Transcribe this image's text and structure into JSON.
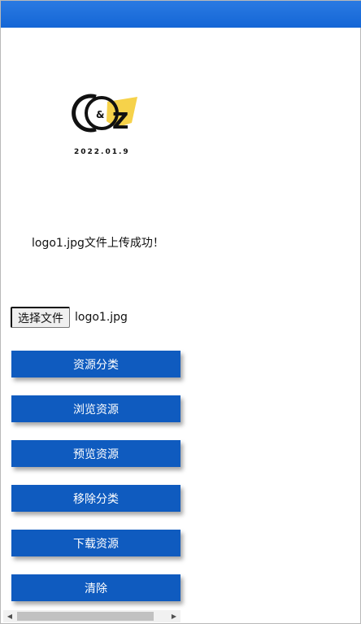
{
  "header": {
    "color": "#1466d6"
  },
  "logo": {
    "text": "C & Z",
    "date": "2022.01.9",
    "accent_color": "#f6d24a"
  },
  "upload": {
    "message": "logo1.jpg文件上传成功！"
  },
  "file_input": {
    "button_label": "选择文件",
    "file_name": "logo1.jpg"
  },
  "actions": [
    {
      "label": "资源分类"
    },
    {
      "label": "浏览资源"
    },
    {
      "label": "预览资源"
    },
    {
      "label": "移除分类"
    },
    {
      "label": "下载资源"
    },
    {
      "label": "清除"
    }
  ],
  "colors": {
    "button_bg": "#0f5bbf",
    "button_text": "#ffffff"
  },
  "scrollbar": {
    "left_arrow_icon": "triangle-left",
    "right_arrow_icon": "triangle-right"
  }
}
